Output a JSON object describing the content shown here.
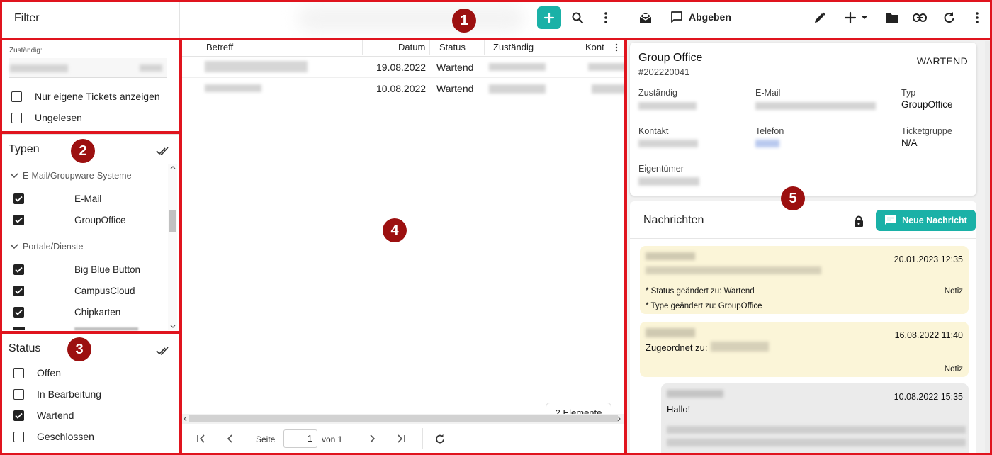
{
  "colors": {
    "accent": "#1ab1a7",
    "annotation": "#e0141e",
    "marker": "#9c1010",
    "note_bg": "#fbf5d8",
    "message_bg": "#ebebeb"
  },
  "markers": [
    "1",
    "2",
    "3",
    "4",
    "5"
  ],
  "header": {
    "filter_title": "Filter",
    "add_icon": "plus-icon",
    "abgeben_label": "Abgeben",
    "icons": [
      "search-icon",
      "more-vert-icon",
      "mail-open-icon",
      "feedback-icon",
      "pencil-icon",
      "add-dropdown-icon",
      "folder-icon",
      "link-icon",
      "refresh-icon",
      "more-vert-icon"
    ]
  },
  "filters": {
    "zustaendig_label": "Zuständig:",
    "options": [
      {
        "label": "Nur eigene Tickets anzeigen",
        "checked": false
      },
      {
        "label": "Ungelesen",
        "checked": false
      }
    ]
  },
  "typen": {
    "title": "Typen",
    "groups": [
      {
        "label": "E-Mail/Groupware-Systeme",
        "items": [
          {
            "label": "E-Mail",
            "checked": true
          },
          {
            "label": "GroupOffice",
            "checked": true
          }
        ]
      },
      {
        "label": "Portale/Dienste",
        "items": [
          {
            "label": "Big Blue Button",
            "checked": true
          },
          {
            "label": "CampusCloud",
            "checked": true
          },
          {
            "label": "Chipkarten",
            "checked": true
          }
        ]
      }
    ]
  },
  "status": {
    "title": "Status",
    "items": [
      {
        "label": "Offen",
        "checked": false
      },
      {
        "label": "In Bearbeitung",
        "checked": false
      },
      {
        "label": "Wartend",
        "checked": true
      },
      {
        "label": "Geschlossen",
        "checked": false
      }
    ]
  },
  "table": {
    "columns": [
      "Betreff",
      "Datum",
      "Status",
      "Zuständig",
      "Kont"
    ],
    "rows": [
      {
        "datum": "19.08.2022",
        "status": "Wartend"
      },
      {
        "datum": "10.08.2022",
        "status": "Wartend"
      }
    ],
    "count_label": "2 Elemente",
    "pager": {
      "seite_label": "Seite",
      "page": "1",
      "von_label": "von 1"
    }
  },
  "ticket": {
    "title": "Group Office",
    "id": "#202220041",
    "status": "WARTEND",
    "fields": {
      "zustaendig": "Zuständig",
      "email": "E-Mail",
      "typ": "Typ",
      "typ_value": "GroupOffice",
      "kontakt": "Kontakt",
      "telefon": "Telefon",
      "ticketgruppe": "Ticketgruppe",
      "ticketgruppe_value": "N/A",
      "eigentuemer": "Eigentümer"
    }
  },
  "messages": {
    "title": "Nachrichten",
    "new_button": "Neue Nachricht",
    "items": [
      {
        "time": "20.01.2023 12:35",
        "line1": "* Status geändert zu: Wartend",
        "line2": "* Type geändert zu: GroupOffice",
        "tag": "Notiz"
      },
      {
        "time": "16.08.2022 11:40",
        "line1": "Zugeordnet zu:",
        "tag": "Notiz"
      },
      {
        "time": "10.08.2022 15:35",
        "line1": "Hallo!"
      }
    ]
  }
}
